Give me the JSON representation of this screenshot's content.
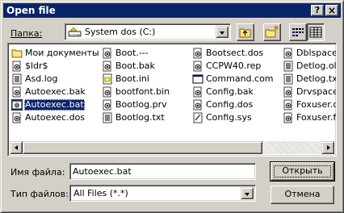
{
  "window": {
    "title": "Open file",
    "help_button": "?",
    "close_button": "×"
  },
  "location": {
    "label": "Папка:",
    "value": "System dos (C:)"
  },
  "toolbar": {
    "up_folder": "up-one-level",
    "new_folder": "create-new-folder",
    "list_view": "list",
    "details_view": "details"
  },
  "files": {
    "columns": [
      [
        {
          "name": "Мои документы",
          "icon": "folder"
        },
        {
          "name": "$ldr$",
          "icon": "system"
        },
        {
          "name": "Asd.log",
          "icon": "text"
        },
        {
          "name": "Autoexec.bak",
          "icon": "system"
        },
        {
          "name": "Autoexec.bat",
          "icon": "batch",
          "selected": true
        },
        {
          "name": "Autoexec.dos",
          "icon": "system"
        }
      ],
      [
        {
          "name": "Boot.---",
          "icon": "system"
        },
        {
          "name": "Boot.bak",
          "icon": "system"
        },
        {
          "name": "Boot.ini",
          "icon": "settings"
        },
        {
          "name": "bootfont.bin",
          "icon": "system"
        },
        {
          "name": "Bootlog.prv",
          "icon": "system"
        },
        {
          "name": "Bootlog.txt",
          "icon": "text"
        }
      ],
      [
        {
          "name": "Bootsect.dos",
          "icon": "system"
        },
        {
          "name": "CCPW40.rep",
          "icon": "system"
        },
        {
          "name": "Command.com",
          "icon": "app"
        },
        {
          "name": "Config.bak",
          "icon": "system"
        },
        {
          "name": "Config.dos",
          "icon": "system"
        },
        {
          "name": "Config.sys",
          "icon": "config"
        }
      ],
      [
        {
          "name": "Dblspace.ini",
          "icon": "system"
        },
        {
          "name": "Detlog.old",
          "icon": "text"
        },
        {
          "name": "Detlog.txt",
          "icon": "text"
        },
        {
          "name": "Drvspace.bin",
          "icon": "system"
        },
        {
          "name": "Foxuser.dbf",
          "icon": "system"
        },
        {
          "name": "Foxuser.fpt",
          "icon": "system"
        }
      ]
    ]
  },
  "filename": {
    "label": "Имя файла:",
    "value": "Autoexec.bat"
  },
  "filetype": {
    "label": "Тип файлов:",
    "value": "All Files (*.*)"
  },
  "buttons": {
    "open": "Открыть",
    "cancel": "Отмена"
  }
}
